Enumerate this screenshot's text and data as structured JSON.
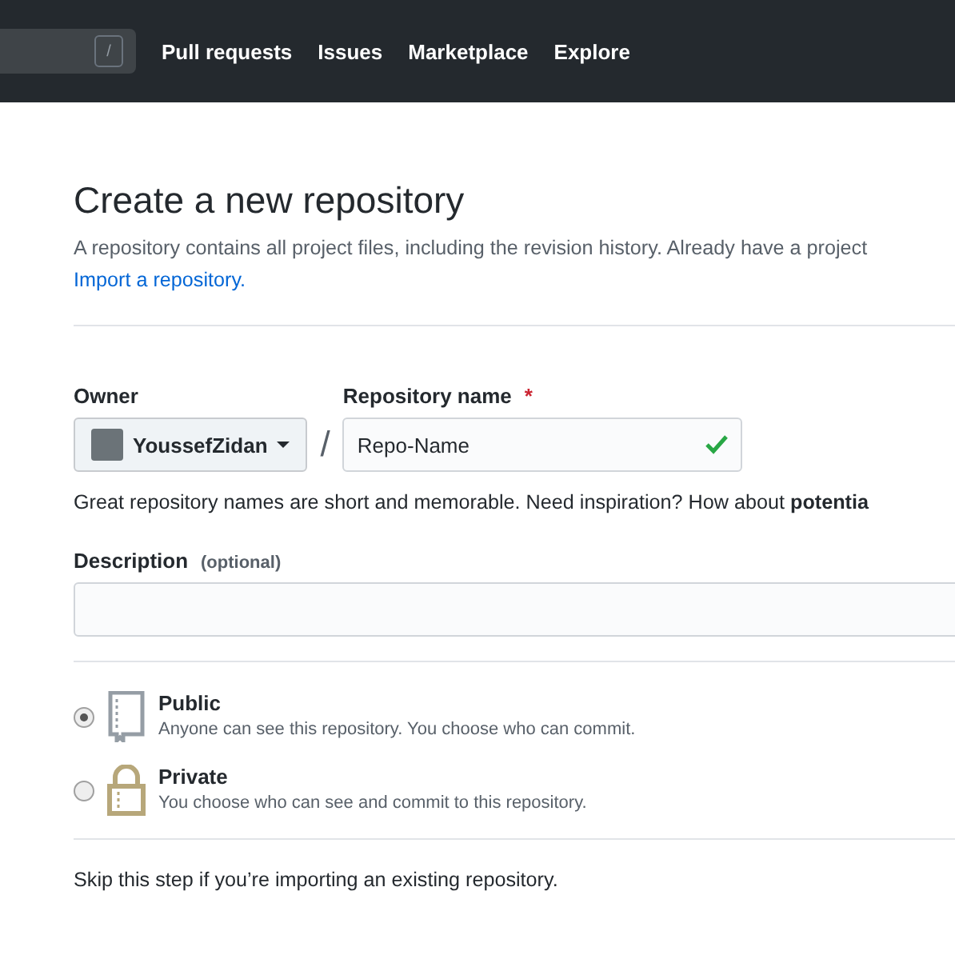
{
  "header": {
    "search_key": "/",
    "nav": [
      "Pull requests",
      "Issues",
      "Marketplace",
      "Explore"
    ]
  },
  "title": "Create a new repository",
  "intro": "A repository contains all project files, including the revision history. Already have a project",
  "import_link": "Import a repository.",
  "owner": {
    "label": "Owner",
    "value": "YoussefZidan"
  },
  "separator": "/",
  "repo_name": {
    "label": "Repository name",
    "required_mark": "*",
    "value": "Repo-Name",
    "valid": true
  },
  "name_hint": "Great repository names are short and memorable. Need inspiration? How about **potentia**",
  "description": {
    "label": "Description",
    "optional": "(optional)"
  },
  "visibility": [
    {
      "kind": "public",
      "label": "Public",
      "hint": "Anyone can see this repository. You choose who can commit.",
      "selected": true
    },
    {
      "kind": "private",
      "label": "Private",
      "hint": "You choose who can see and commit to this repository.",
      "selected": false
    }
  ],
  "skip_note": "Skip this step if you’re importing an existing repository."
}
